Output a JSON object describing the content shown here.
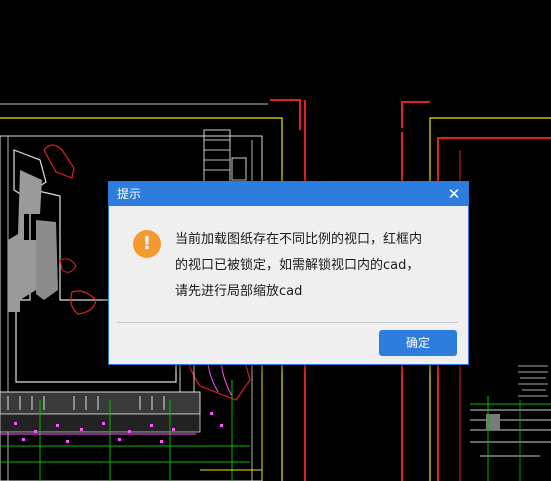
{
  "dialog": {
    "title": "提示",
    "close_glyph": "✕",
    "icon": "warning-icon",
    "icon_glyph": "!",
    "message_lines": [
      "当前加载图纸存在不同比例的视口，红框内",
      "的视口已被锁定，如需解锁视口内的cad，",
      "请先进行局部缩放cad"
    ],
    "confirm_label": "确定"
  },
  "colors": {
    "canvas_background": "#000000",
    "titlebar": "#2c7ddd",
    "dialog_body": "#efefef",
    "warning_icon": "#f39a2e",
    "locked_viewport_frame": "#e02020",
    "drawing_frame": "#e6e600"
  }
}
